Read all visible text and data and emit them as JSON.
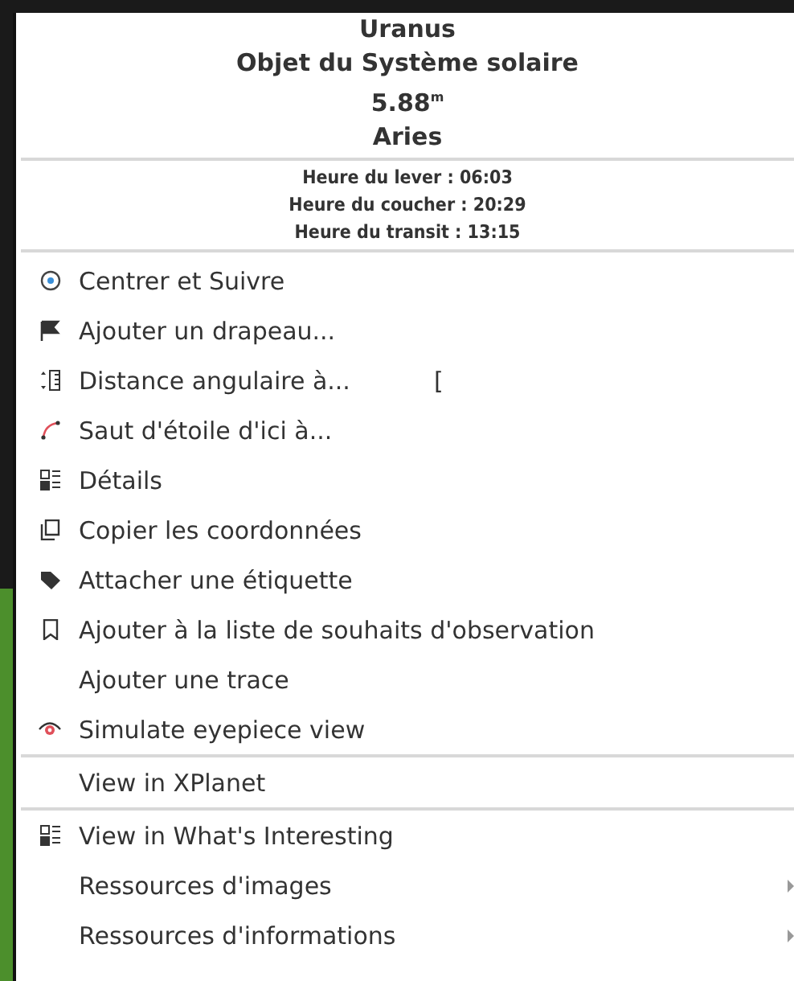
{
  "header": {
    "title_lines": [
      "Uranus",
      "Objet du Système solaire",
      "5.88$^{m}$",
      "Aries"
    ],
    "times": [
      "Heure du lever : 06:03",
      "Heure du coucher : 20:29",
      "Heure du transit : 13:15"
    ]
  },
  "menu": [
    {
      "kind": "item",
      "label": "Centrer et Suivre",
      "submenu": false
    },
    {
      "kind": "item",
      "label": "Ajouter un drapeau...",
      "submenu": false
    },
    {
      "kind": "item",
      "label": "Distance angulaire à...",
      "shortcut": "[",
      "submenu": false
    },
    {
      "kind": "item",
      "label": "Saut d'étoile d'ici à...",
      "submenu": false
    },
    {
      "kind": "item",
      "label": "Détails",
      "submenu": false
    },
    {
      "kind": "item",
      "label": "Copier les coordonnées",
      "submenu": false
    },
    {
      "kind": "item",
      "label": "Attacher une étiquette",
      "submenu": false
    },
    {
      "kind": "item",
      "label": "Ajouter à la liste de souhaits d'observation",
      "submenu": false
    },
    {
      "kind": "item",
      "label": "Ajouter une trace",
      "submenu": false
    },
    {
      "kind": "item",
      "label": "Simulate eyepiece view",
      "submenu": false
    },
    {
      "kind": "separator"
    },
    {
      "kind": "item",
      "label": "View in XPlanet",
      "submenu": false
    },
    {
      "kind": "separator"
    },
    {
      "kind": "item",
      "label": "View in What's Interesting",
      "submenu": false
    },
    {
      "kind": "item",
      "label": "Ressources d'images",
      "submenu": true
    },
    {
      "kind": "item",
      "label": "Ressources d'informations",
      "submenu": true
    }
  ]
}
